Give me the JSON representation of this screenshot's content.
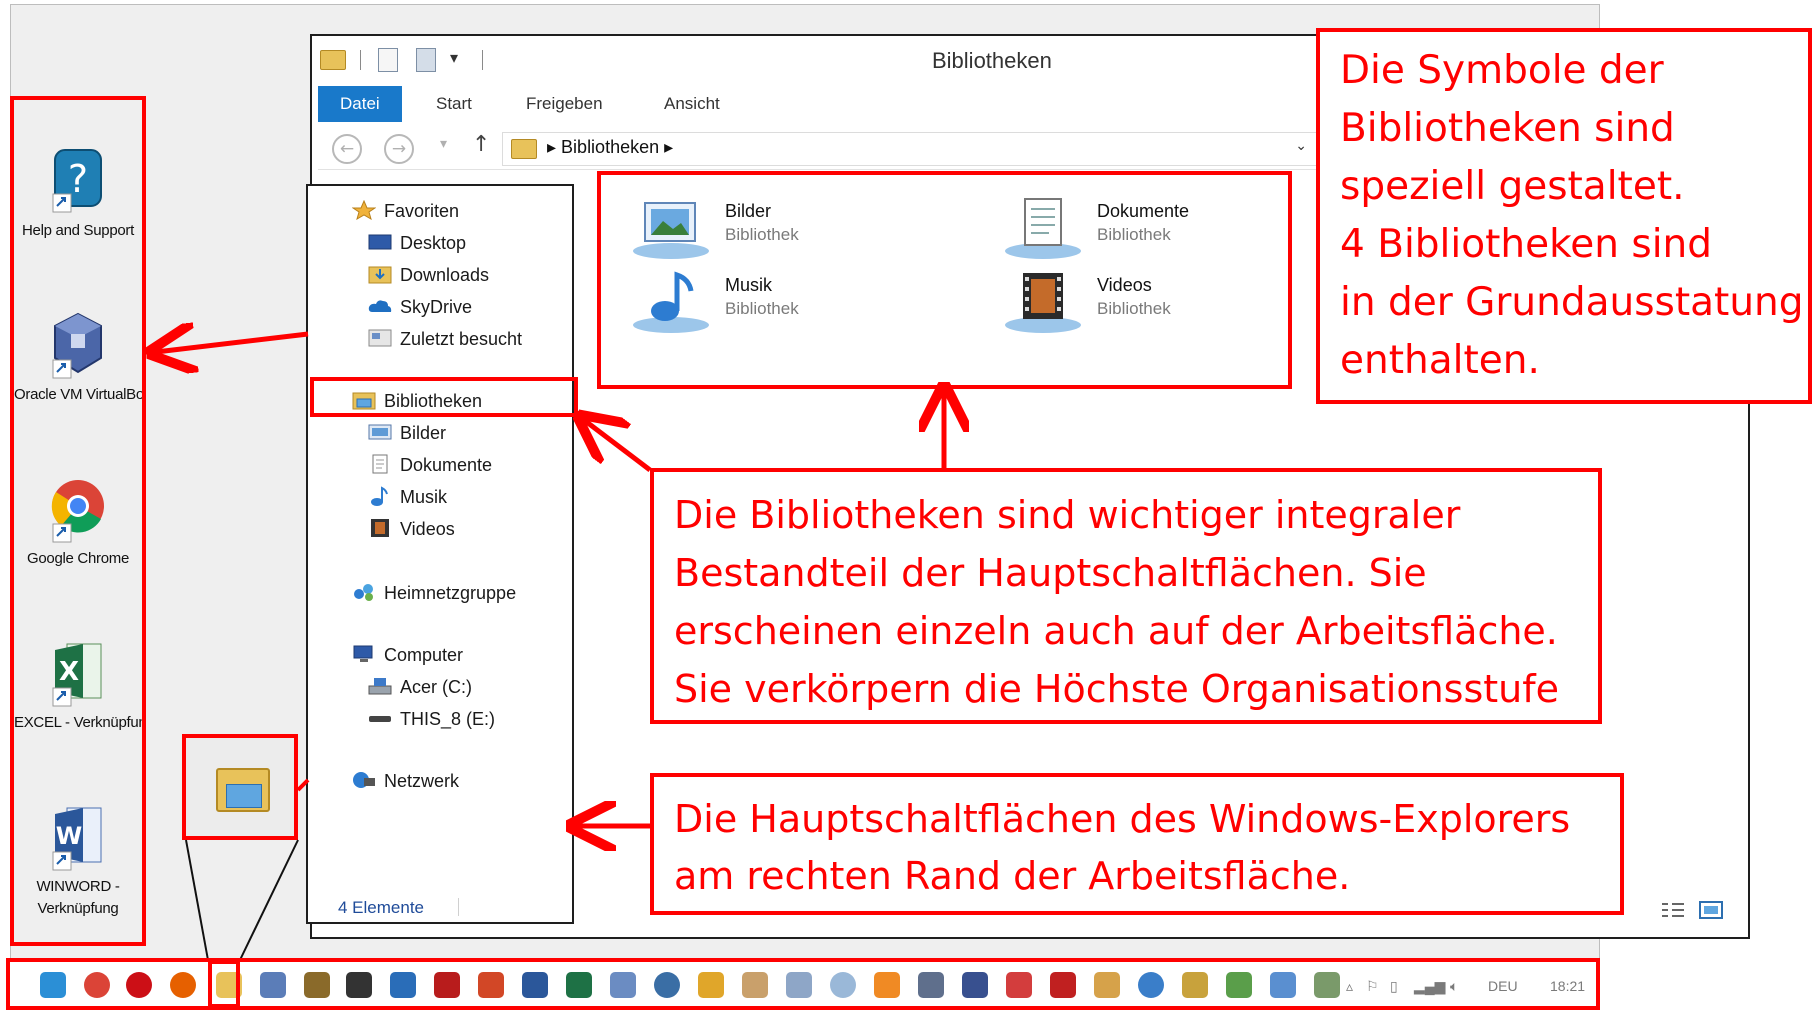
{
  "desktop_icons": [
    {
      "label": "Help and Support",
      "icon": "help-icon"
    },
    {
      "label": "Oracle VM VirtualBox",
      "icon": "virtualbox-icon"
    },
    {
      "label": "Google Chrome",
      "icon": "chrome-icon"
    },
    {
      "label": "EXCEL - Verknüpfung",
      "icon": "excel-icon"
    },
    {
      "label": "WINWORD -",
      "label2": "Verknüpfung",
      "icon": "word-icon"
    }
  ],
  "explorer": {
    "title": "Bibliotheken",
    "ribbon_tabs": [
      "Datei",
      "Start",
      "Freigeben",
      "Ansicht"
    ],
    "breadcrumb": "Bibliotheken",
    "nav": {
      "favorites": "Favoriten",
      "desktop": "Desktop",
      "downloads": "Downloads",
      "skydrive": "SkyDrive",
      "recent": "Zuletzt besucht",
      "libraries": "Bibliotheken",
      "pictures": "Bilder",
      "documents": "Dokumente",
      "music": "Musik",
      "videos": "Videos",
      "homegroup": "Heimnetzgruppe",
      "computer": "Computer",
      "drive_c": "Acer (C:)",
      "drive_e": "THIS_8 (E:)",
      "network": "Netzwerk"
    },
    "libraries": [
      {
        "name": "Bilder",
        "type": "Bibliothek"
      },
      {
        "name": "Dokumente",
        "type": "Bibliothek"
      },
      {
        "name": "Musik",
        "type": "Bibliothek"
      },
      {
        "name": "Videos",
        "type": "Bibliothek"
      }
    ],
    "status": "4 Elemente"
  },
  "callouts": {
    "one": [
      "Die Symbole der",
      "Bibliotheken sind",
      "speziell gestaltet.",
      "4 Bibliotheken sind",
      "in der Grundausstatung",
      "enthalten."
    ],
    "two": [
      "Die Bibliotheken sind wichtiger integraler",
      "Bestandteil der Hauptschaltflächen. Sie",
      "erscheinen einzeln auch auf der Arbeitsfläche.",
      "Sie verkörpern die Höchste Organisationsstufe"
    ],
    "three": [
      "Die Hauptschaltflächen des Windows-Explorers",
      "am rechten Rand der Arbeitsfläche."
    ]
  },
  "taskbar": {
    "language": "DEU",
    "time": "18:21"
  },
  "colors": {
    "annotation": "#ff0000",
    "ribbon_active": "#1979ca",
    "link": "#1f4b99"
  }
}
